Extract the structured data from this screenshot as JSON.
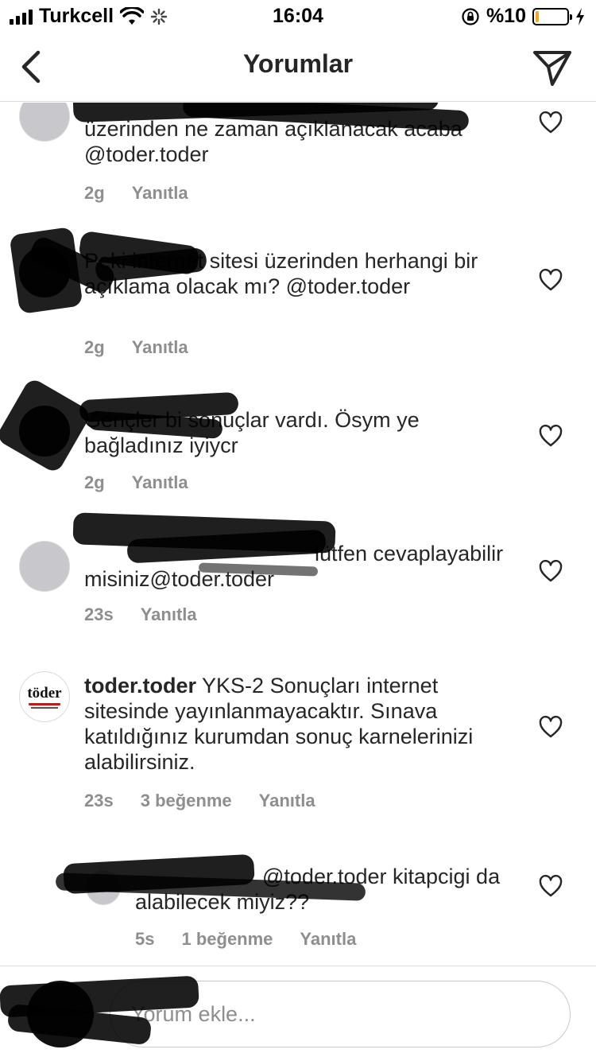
{
  "status_bar": {
    "carrier": "Turkcell",
    "time": "16:04",
    "battery_text": "%10",
    "battery_level": 0.1,
    "icons": [
      "signal-icon",
      "wifi-icon",
      "activity-spinner-icon",
      "orientation-lock-icon",
      "battery-icon",
      "charging-bolt-icon"
    ]
  },
  "nav": {
    "title": "Yorumlar",
    "back_icon": "chevron-left-icon",
    "send_icon": "paper-plane-icon"
  },
  "comments": [
    {
      "user": "",
      "text": "üzerinden ne zaman açıklanacak acaba @toder.toder",
      "time": "2g",
      "likes": "",
      "reply": "Yanıtla"
    },
    {
      "user": "",
      "text": "Peki internet sitesi üzerinden herhangi bir açıklama olacak mı? @toder.toder",
      "time": "2g",
      "likes": "",
      "reply": "Yanıtla"
    },
    {
      "user": "",
      "text": "Gençler bi sonuçlar vardı. Ösym ye bağladınız iyiycr",
      "time": "2g",
      "likes": "",
      "reply": "Yanıtla"
    },
    {
      "user": "",
      "text": "lütfen cevaplayabilir misiniz@toder.toder",
      "time": "23s",
      "likes": "",
      "reply": "Yanıtla"
    },
    {
      "user": "toder.toder",
      "text": "YKS-2 Sonuçları internet sitesinde yayınlanmayacaktır. Sınava katıldığınız kurumdan sonuç karnelerinizi alabilirsiniz.",
      "time": "23s",
      "likes": "3 beğenme",
      "reply": "Yanıtla",
      "avatar_logo": "töder"
    },
    {
      "user": "",
      "text": "@toder.toder kitapcigi da alabilecek miyiz??",
      "time": "5s",
      "likes": "1 beğenme",
      "reply": "Yanıtla"
    }
  ],
  "composer": {
    "placeholder": "Yorum ekle..."
  }
}
